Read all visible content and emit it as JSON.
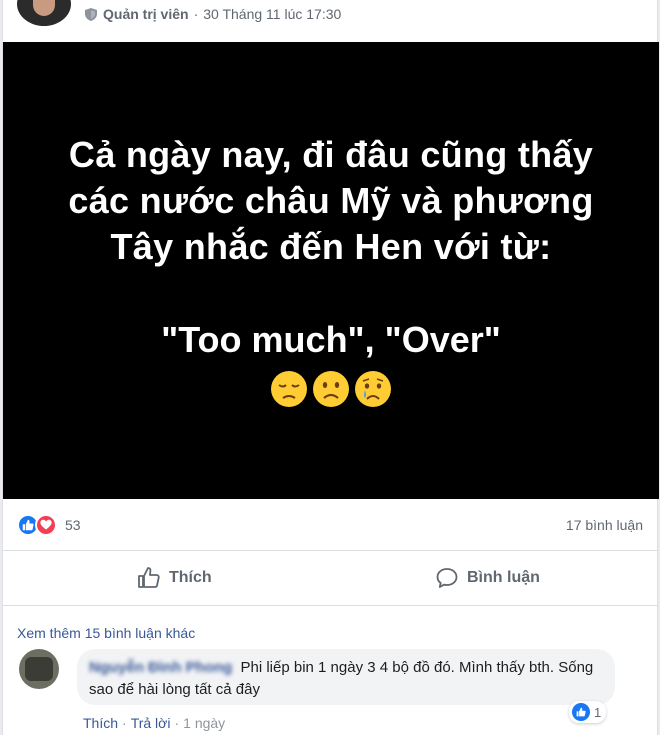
{
  "post": {
    "author_role": "Quản trị viên",
    "timestamp": "30 Tháng 11 lúc 17:30",
    "image_text_lines": [
      "Cả ngày nay, đi đâu cũng thấy",
      "các nước châu Mỹ và phương",
      "Tây nhắc đến Hen với từ:"
    ],
    "image_quote": "\"Too much\", \"Over\"",
    "emojis": [
      "pensive-face-emoji",
      "frowning-face-emoji",
      "crying-face-emoji"
    ]
  },
  "reactions": {
    "count": "53",
    "comments_label": "17 bình luận"
  },
  "actions": {
    "like_label": "Thích",
    "comment_label": "Bình luận"
  },
  "comments": {
    "more_label": "Xem thêm 15 bình luận khác",
    "items": [
      {
        "author": "Nguyễn Đình Phong",
        "text": "Phi liếp bin 1 ngày 3 4 bộ đồ đó. Mình thấy bth. Sống sao để hài lòng tất cả đây",
        "like_count": "1",
        "like_label": "Thích",
        "reply_label": "Trả lời",
        "time": "1 ngày"
      }
    ]
  },
  "colors": {
    "link_blue": "#385898",
    "like_blue": "#1877f2",
    "love_red": "#f33e58",
    "muted_text": "#606770"
  }
}
